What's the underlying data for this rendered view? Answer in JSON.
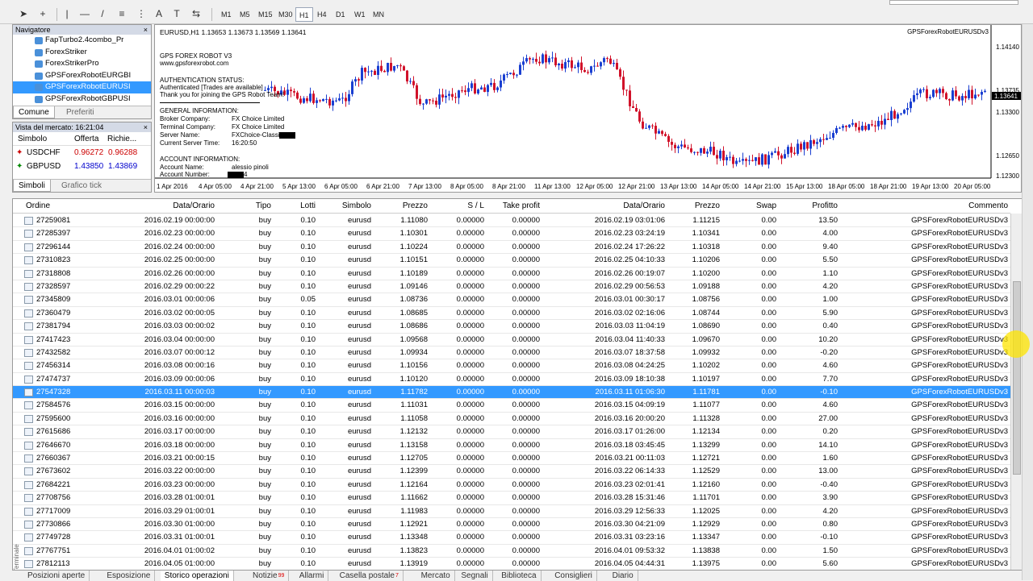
{
  "toolbar": {
    "timeframes": [
      "M1",
      "M5",
      "M15",
      "M30",
      "H1",
      "H4",
      "D1",
      "W1",
      "MN"
    ],
    "selected_timeframe": "H1",
    "tools": [
      "cursor-icon",
      "crosshair-icon",
      "vertical-line-icon",
      "horizontal-line-icon",
      "trendline-icon",
      "channel-icon",
      "text-icon",
      "label-icon",
      "shapes-icon"
    ]
  },
  "navigator": {
    "title": "Navigatore",
    "items": [
      "FapTurbo2.4combo_Pr",
      "ForexStriker",
      "ForexStrikerPro",
      "GPSForexRobotEURGBI",
      "GPSForexRobotEURUSI",
      "GPSForexRobotGBPUSI"
    ],
    "selected_index": 4,
    "tabs": [
      "Comune",
      "Preferiti"
    ],
    "active_tab": "Comune"
  },
  "market_watch": {
    "title": "Vista del mercato: 16:21:04",
    "headers": [
      "Simbolo",
      "Offerta",
      "Richie..."
    ],
    "rows": [
      {
        "symbol": "USDCHF",
        "bid": "0.96272",
        "ask": "0.96288",
        "dir": "down"
      },
      {
        "symbol": "GBPUSD",
        "bid": "1.43850",
        "ask": "1.43869",
        "dir": "up"
      }
    ],
    "tabs": [
      "Simboli",
      "Grafico tick"
    ],
    "active_tab": "Simboli"
  },
  "chart": {
    "header": "EURUSD,H1  1.13653 1.13673 1.13569 1.13641",
    "ea_label": "GPSForexRobotEURUSDv3",
    "price_marker": "1.13641",
    "price_ticks": [
      "1.14140",
      "1.13735",
      "1.13300",
      "1.12650",
      "1.12300"
    ],
    "time_ticks": [
      "1 Apr 2016",
      "4 Apr 05:00",
      "4 Apr 21:00",
      "5 Apr 13:00",
      "6 Apr 05:00",
      "6 Apr 21:00",
      "7 Apr 13:00",
      "8 Apr 05:00",
      "8 Apr 21:00",
      "11 Apr 13:00",
      "12 Apr 05:00",
      "12 Apr 21:00",
      "13 Apr 13:00",
      "14 Apr 05:00",
      "14 Apr 21:00",
      "15 Apr 13:00",
      "18 Apr 05:00",
      "18 Apr 21:00",
      "19 Apr 13:00",
      "20 Apr 05:00"
    ],
    "overlay": {
      "title": "GPS FOREX ROBOT V3",
      "site": "www.gpsforexrobot.com",
      "auth_title": "AUTHENTICATION STATUS:",
      "auth_line1": "Authenticated [Trades are available]",
      "auth_line2": "Thank you for joining the GPS Robot Team!",
      "gen_title": "GENERAL INFORMATION:",
      "broker_label": "Broker Company:",
      "broker": "FX Choice Limited",
      "terminal_label": "Terminal Company:",
      "terminal": "FX Choice Limited",
      "server_label": "Server Name:",
      "server": "FXChoice-Classic",
      "time_label": "Current Server Time:",
      "time": "16:20:50",
      "acc_title": "ACCOUNT INFORMATION:",
      "accname_label": "Account Name:",
      "accname": "alessio pinoli",
      "accnum_label": "Account Number:",
      "accnum": "4"
    }
  },
  "table": {
    "headers": {
      "order": "Ordine",
      "open_time": "Data/Orario",
      "type": "Tipo",
      "lots": "Lotti",
      "symbol": "Simbolo",
      "price": "Prezzo",
      "sl": "S / L",
      "tp": "Take profit",
      "close_time": "Data/Orario",
      "close_price": "Prezzo",
      "swap": "Swap",
      "profit": "Profitto",
      "comment": "Commento"
    },
    "rows": [
      [
        "27259081",
        "2016.02.19 00:00:00",
        "buy",
        "0.10",
        "eurusd",
        "1.11080",
        "0.00000",
        "0.00000",
        "2016.02.19 03:01:06",
        "1.11215",
        "0.00",
        "13.50",
        "GPSForexRobotEURUSDv3"
      ],
      [
        "27285397",
        "2016.02.23 00:00:00",
        "buy",
        "0.10",
        "eurusd",
        "1.10301",
        "0.00000",
        "0.00000",
        "2016.02.23 03:24:19",
        "1.10341",
        "0.00",
        "4.00",
        "GPSForexRobotEURUSDv3"
      ],
      [
        "27296144",
        "2016.02.24 00:00:00",
        "buy",
        "0.10",
        "eurusd",
        "1.10224",
        "0.00000",
        "0.00000",
        "2016.02.24 17:26:22",
        "1.10318",
        "0.00",
        "9.40",
        "GPSForexRobotEURUSDv3"
      ],
      [
        "27310823",
        "2016.02.25 00:00:00",
        "buy",
        "0.10",
        "eurusd",
        "1.10151",
        "0.00000",
        "0.00000",
        "2016.02.25 04:10:33",
        "1.10206",
        "0.00",
        "5.50",
        "GPSForexRobotEURUSDv3"
      ],
      [
        "27318808",
        "2016.02.26 00:00:00",
        "buy",
        "0.10",
        "eurusd",
        "1.10189",
        "0.00000",
        "0.00000",
        "2016.02.26 00:19:07",
        "1.10200",
        "0.00",
        "1.10",
        "GPSForexRobotEURUSDv3"
      ],
      [
        "27328597",
        "2016.02.29 00:00:22",
        "buy",
        "0.10",
        "eurusd",
        "1.09146",
        "0.00000",
        "0.00000",
        "2016.02.29 00:56:53",
        "1.09188",
        "0.00",
        "4.20",
        "GPSForexRobotEURUSDv3"
      ],
      [
        "27345809",
        "2016.03.01 00:00:06",
        "buy",
        "0.05",
        "eurusd",
        "1.08736",
        "0.00000",
        "0.00000",
        "2016.03.01 00:30:17",
        "1.08756",
        "0.00",
        "1.00",
        "GPSForexRobotEURUSDv3"
      ],
      [
        "27360479",
        "2016.03.02 00:00:05",
        "buy",
        "0.10",
        "eurusd",
        "1.08685",
        "0.00000",
        "0.00000",
        "2016.03.02 02:16:06",
        "1.08744",
        "0.00",
        "5.90",
        "GPSForexRobotEURUSDv3"
      ],
      [
        "27381794",
        "2016.03.03 00:00:02",
        "buy",
        "0.10",
        "eurusd",
        "1.08686",
        "0.00000",
        "0.00000",
        "2016.03.03 11:04:19",
        "1.08690",
        "0.00",
        "0.40",
        "GPSForexRobotEURUSDv3"
      ],
      [
        "27417423",
        "2016.03.04 00:00:00",
        "buy",
        "0.10",
        "eurusd",
        "1.09568",
        "0.00000",
        "0.00000",
        "2016.03.04 11:40:33",
        "1.09670",
        "0.00",
        "10.20",
        "GPSForexRobotEURUSDv3"
      ],
      [
        "27432582",
        "2016.03.07 00:00:12",
        "buy",
        "0.10",
        "eurusd",
        "1.09934",
        "0.00000",
        "0.00000",
        "2016.03.07 18:37:58",
        "1.09932",
        "0.00",
        "-0.20",
        "GPSForexRobotEURUSDv3"
      ],
      [
        "27456314",
        "2016.03.08 00:00:16",
        "buy",
        "0.10",
        "eurusd",
        "1.10156",
        "0.00000",
        "0.00000",
        "2016.03.08 04:24:25",
        "1.10202",
        "0.00",
        "4.60",
        "GPSForexRobotEURUSDv3"
      ],
      [
        "27474737",
        "2016.03.09 00:00:06",
        "buy",
        "0.10",
        "eurusd",
        "1.10120",
        "0.00000",
        "0.00000",
        "2016.03.09 18:10:38",
        "1.10197",
        "0.00",
        "7.70",
        "GPSForexRobotEURUSDv3"
      ],
      [
        "27547328",
        "2016.03.11 00:00:03",
        "buy",
        "0.10",
        "eurusd",
        "1.11782",
        "0.00000",
        "0.00000",
        "2016.03.11 01:06:30",
        "1.11781",
        "0.00",
        "-0.10",
        "GPSForexRobotEURUSDv3"
      ],
      [
        "27584576",
        "2016.03.15 00:00:00",
        "buy",
        "0.10",
        "eurusd",
        "1.11031",
        "0.00000",
        "0.00000",
        "2016.03.15 04:09:19",
        "1.11077",
        "0.00",
        "4.60",
        "GPSForexRobotEURUSDv3"
      ],
      [
        "27595600",
        "2016.03.16 00:00:00",
        "buy",
        "0.10",
        "eurusd",
        "1.11058",
        "0.00000",
        "0.00000",
        "2016.03.16 20:00:20",
        "1.11328",
        "0.00",
        "27.00",
        "GPSForexRobotEURUSDv3"
      ],
      [
        "27615686",
        "2016.03.17 00:00:00",
        "buy",
        "0.10",
        "eurusd",
        "1.12132",
        "0.00000",
        "0.00000",
        "2016.03.17 01:26:00",
        "1.12134",
        "0.00",
        "0.20",
        "GPSForexRobotEURUSDv3"
      ],
      [
        "27646670",
        "2016.03.18 00:00:00",
        "buy",
        "0.10",
        "eurusd",
        "1.13158",
        "0.00000",
        "0.00000",
        "2016.03.18 03:45:45",
        "1.13299",
        "0.00",
        "14.10",
        "GPSForexRobotEURUSDv3"
      ],
      [
        "27660367",
        "2016.03.21 00:00:15",
        "buy",
        "0.10",
        "eurusd",
        "1.12705",
        "0.00000",
        "0.00000",
        "2016.03.21 00:11:03",
        "1.12721",
        "0.00",
        "1.60",
        "GPSForexRobotEURUSDv3"
      ],
      [
        "27673602",
        "2016.03.22 00:00:00",
        "buy",
        "0.10",
        "eurusd",
        "1.12399",
        "0.00000",
        "0.00000",
        "2016.03.22 06:14:33",
        "1.12529",
        "0.00",
        "13.00",
        "GPSForexRobotEURUSDv3"
      ],
      [
        "27684221",
        "2016.03.23 00:00:00",
        "buy",
        "0.10",
        "eurusd",
        "1.12164",
        "0.00000",
        "0.00000",
        "2016.03.23 02:01:41",
        "1.12160",
        "0.00",
        "-0.40",
        "GPSForexRobotEURUSDv3"
      ],
      [
        "27708756",
        "2016.03.28 01:00:01",
        "buy",
        "0.10",
        "eurusd",
        "1.11662",
        "0.00000",
        "0.00000",
        "2016.03.28 15:31:46",
        "1.11701",
        "0.00",
        "3.90",
        "GPSForexRobotEURUSDv3"
      ],
      [
        "27717009",
        "2016.03.29 01:00:01",
        "buy",
        "0.10",
        "eurusd",
        "1.11983",
        "0.00000",
        "0.00000",
        "2016.03.29 12:56:33",
        "1.12025",
        "0.00",
        "4.20",
        "GPSForexRobotEURUSDv3"
      ],
      [
        "27730866",
        "2016.03.30 01:00:00",
        "buy",
        "0.10",
        "eurusd",
        "1.12921",
        "0.00000",
        "0.00000",
        "2016.03.30 04:21:09",
        "1.12929",
        "0.00",
        "0.80",
        "GPSForexRobotEURUSDv3"
      ],
      [
        "27749728",
        "2016.03.31 01:00:01",
        "buy",
        "0.10",
        "eurusd",
        "1.13348",
        "0.00000",
        "0.00000",
        "2016.03.31 03:23:16",
        "1.13347",
        "0.00",
        "-0.10",
        "GPSForexRobotEURUSDv3"
      ],
      [
        "27767751",
        "2016.04.01 01:00:02",
        "buy",
        "0.10",
        "eurusd",
        "1.13823",
        "0.00000",
        "0.00000",
        "2016.04.01 09:53:32",
        "1.13838",
        "0.00",
        "1.50",
        "GPSForexRobotEURUSDv3"
      ],
      [
        "27812113",
        "2016.04.05 01:00:00",
        "buy",
        "0.10",
        "eurusd",
        "1.13919",
        "0.00000",
        "0.00000",
        "2016.04.05 04:44:31",
        "1.13975",
        "0.00",
        "5.60",
        "GPSForexRobotEURUSDv3"
      ]
    ],
    "selected_index": 13
  },
  "terminal_label": "Terminale",
  "bottom_tabs": [
    {
      "label": "Posizioni aperte"
    },
    {
      "label": "Esposizione"
    },
    {
      "label": "Storico operazioni",
      "active": true
    },
    {
      "label": "Notizie",
      "badge": "99"
    },
    {
      "label": "Allarmi"
    },
    {
      "label": "Casella postale",
      "badge": "7"
    },
    {
      "label": "Mercato"
    },
    {
      "label": "Segnali"
    },
    {
      "label": "Biblioteca"
    },
    {
      "label": "Consiglieri"
    },
    {
      "label": "Diario"
    }
  ]
}
